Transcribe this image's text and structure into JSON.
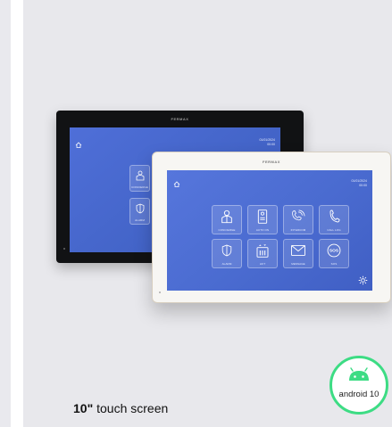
{
  "brand": "FERMAX",
  "screen": {
    "date": "01/01/2024",
    "time": "00:00"
  },
  "tiles": {
    "concierge": "CONCIERGE",
    "auto_on": "AUTO ON",
    "intercom": "INTERCOM",
    "call_log": "CALL LOG",
    "alarm": "ALARM",
    "lift": "LIFT",
    "message": "MESSAGE",
    "sos": "SOS"
  },
  "badge": {
    "label": "android 10",
    "color": "#3ddc84"
  },
  "caption": {
    "size": "10\"",
    "text": " touch screen"
  }
}
